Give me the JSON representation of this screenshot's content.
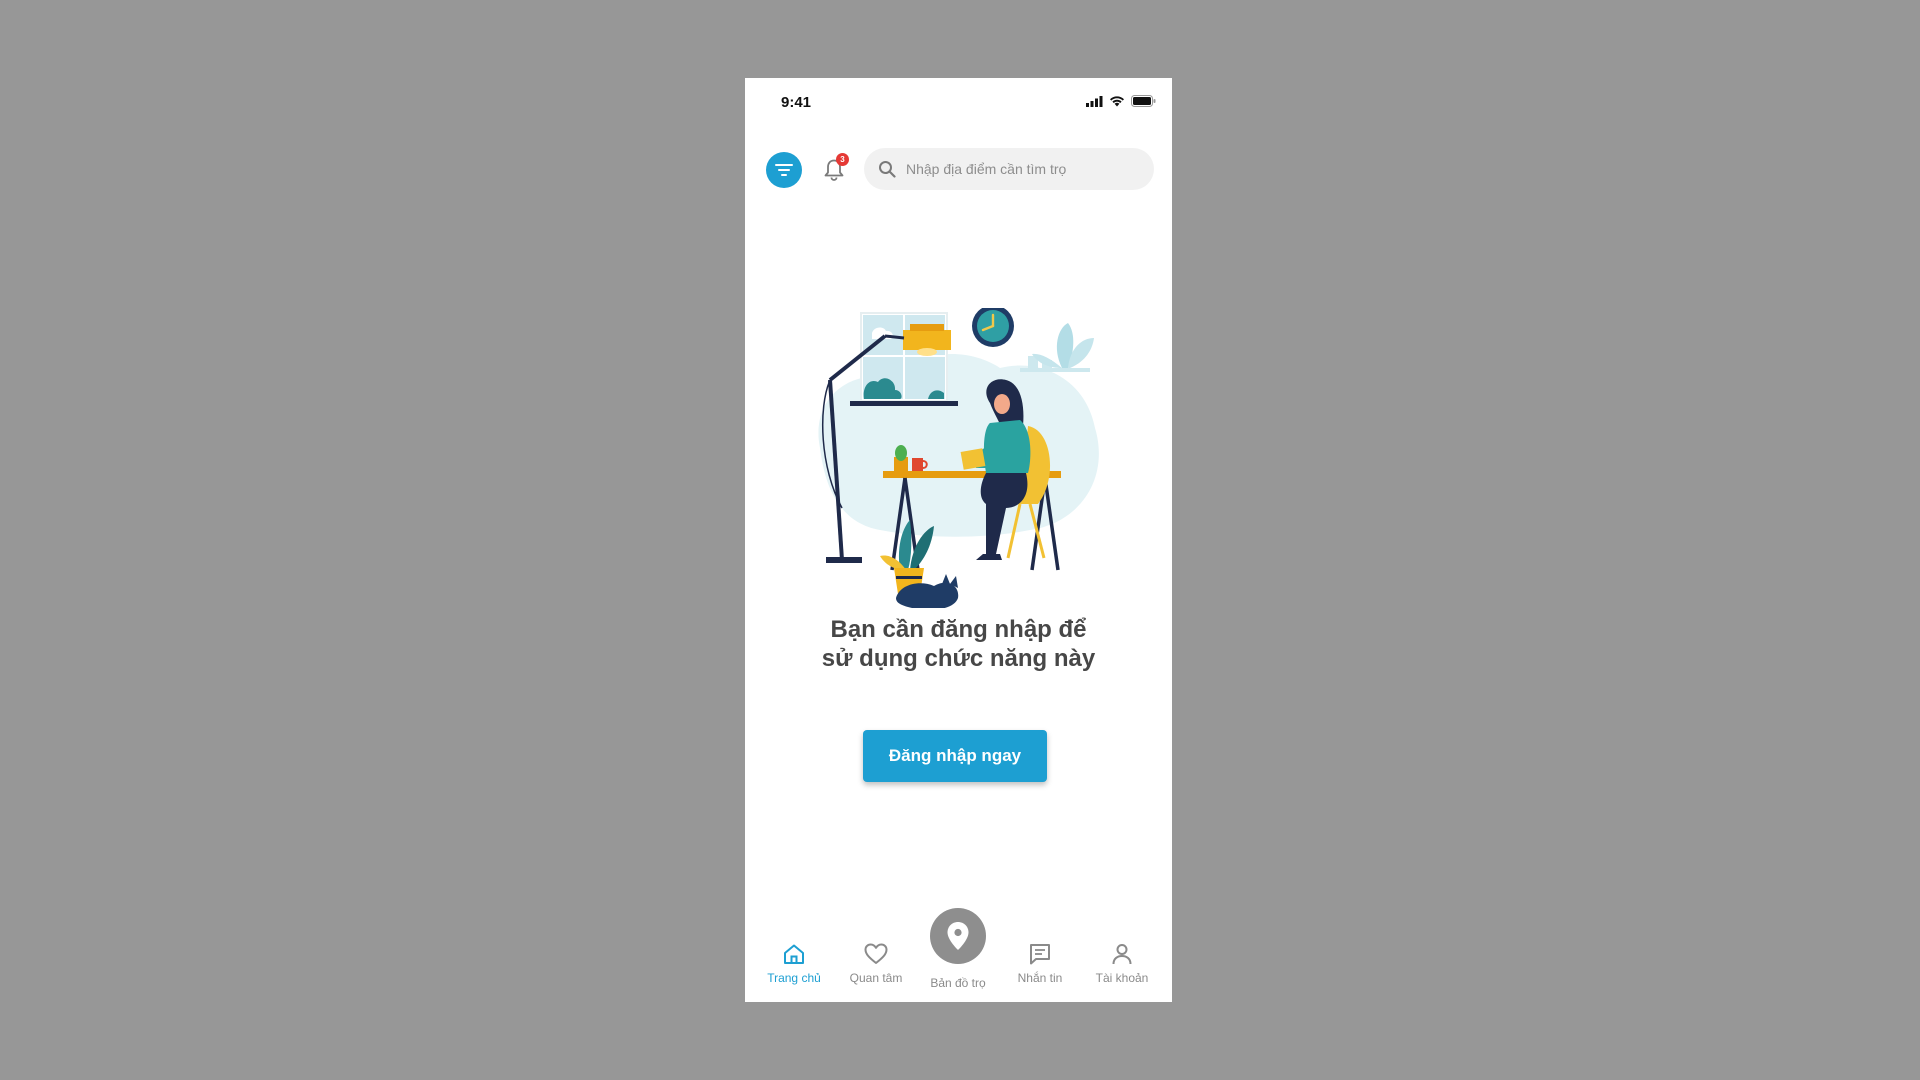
{
  "status_bar": {
    "time": "9:41"
  },
  "header": {
    "filter_icon": "filter-icon",
    "bell_icon": "bell-icon",
    "notification_count": "3",
    "search": {
      "placeholder": "Nhập địa điểm cần tìm trọ",
      "icon": "search-icon"
    }
  },
  "main": {
    "message_line1": "Bạn cần đăng nhập để",
    "message_line2": "sử dụng chức năng này",
    "login_button": "Đăng nhập ngay"
  },
  "bottom_nav": {
    "items": [
      {
        "label": "Trang chủ",
        "icon": "home-icon",
        "active": true
      },
      {
        "label": "Quan tâm",
        "icon": "heart-icon",
        "active": false
      },
      {
        "label": "Bản đồ trọ",
        "icon": "map-pin-icon",
        "active": false
      },
      {
        "label": "Nhắn tin",
        "icon": "chat-icon",
        "active": false
      },
      {
        "label": "Tài khoản",
        "icon": "user-icon",
        "active": false
      }
    ]
  },
  "colors": {
    "primary": "#1d9fd2",
    "background": "#979797",
    "badge": "#e53935",
    "text_dark": "#474747",
    "text_muted": "#8a8a8a"
  }
}
